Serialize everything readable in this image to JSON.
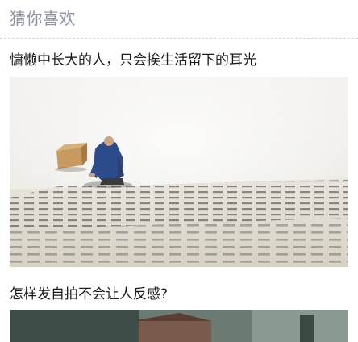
{
  "section": {
    "title": "猜你喜欢"
  },
  "articles": [
    {
      "title": "慵懒中长大的人，只会挨生活留下的耳光",
      "image_alt": "man-kneeling-on-giant-book-page"
    },
    {
      "title": "怎样发自拍不会让人反感?",
      "image_alt": "outdoor-house-photo"
    }
  ]
}
